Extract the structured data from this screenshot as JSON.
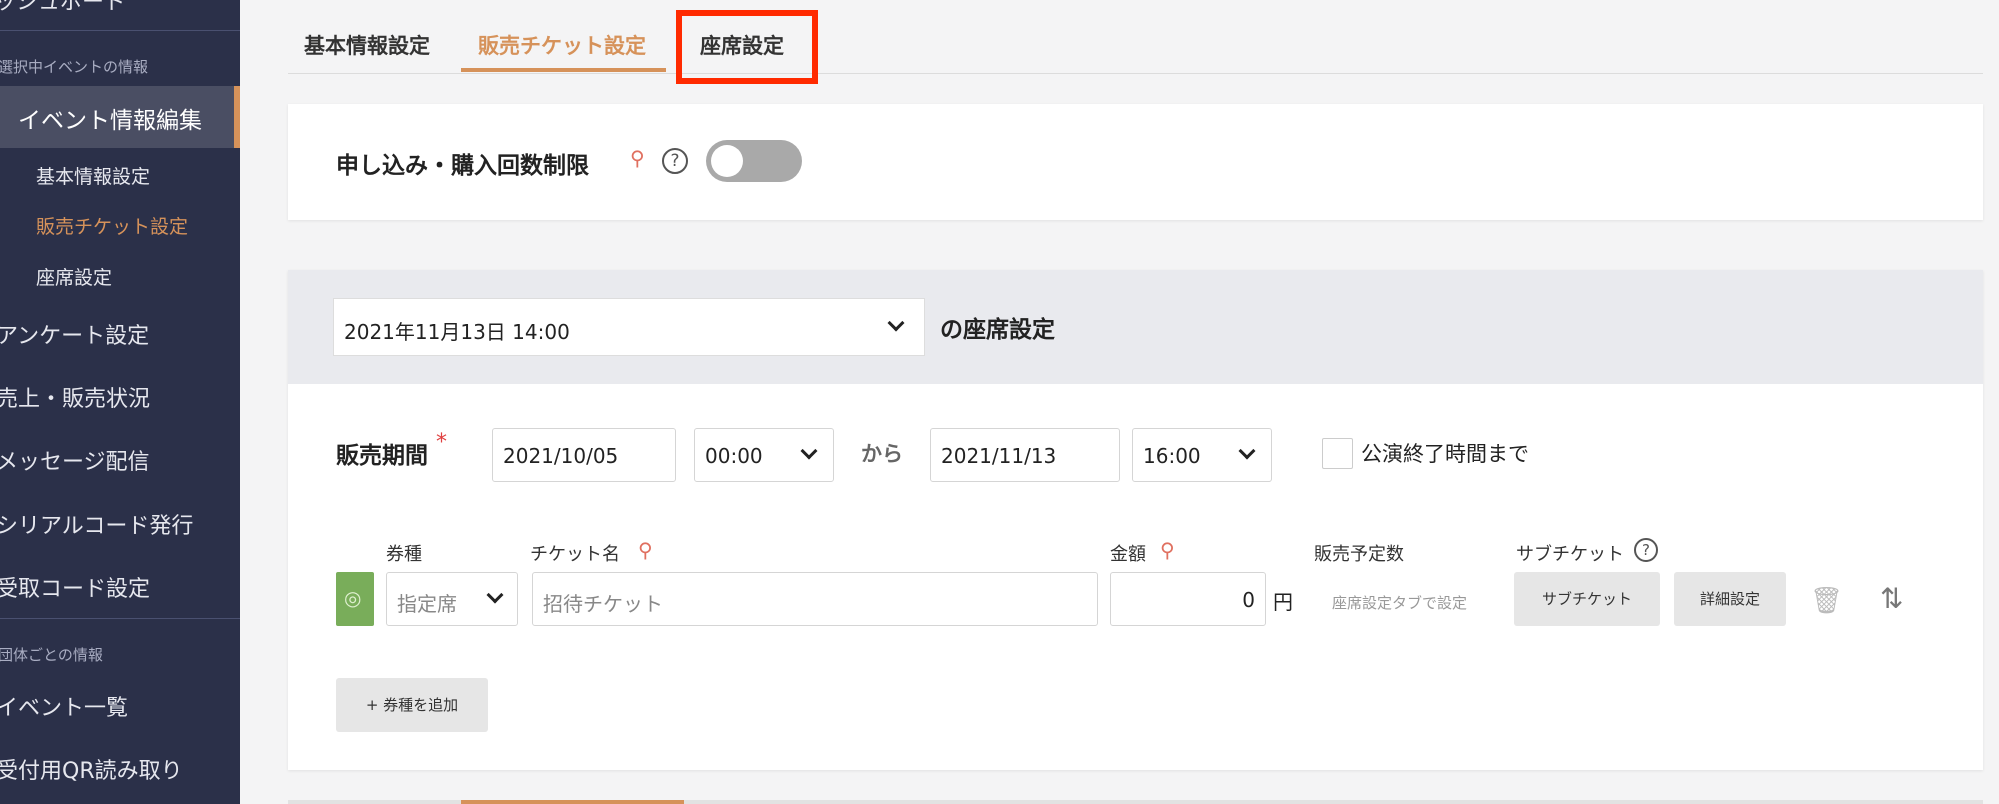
{
  "sidebar": {
    "top_item": "ッシュボード",
    "section_event": "選択中イベントの情報",
    "active_item": "イベント情報編集",
    "sub_items": [
      "基本情報設定",
      "販売チケット設定",
      "座席設定"
    ],
    "items": [
      "アンケート設定",
      "売上・販売状況",
      "メッセージ配信",
      "シリアルコード発行",
      "受取コード設定"
    ],
    "section_org": "団体ごとの情報",
    "org_items": [
      "イベント一覧",
      "受付用QR読み取り"
    ]
  },
  "tabs": [
    "基本情報設定",
    "販売チケット設定",
    "座席設定"
  ],
  "limit": {
    "label": "申し込み・購入回数制限",
    "enabled": false
  },
  "seat_settings": {
    "date_value": "2021年11月13日 14:00",
    "title": "の座席設定"
  },
  "sales_period": {
    "label": "販売期間",
    "required_mark": "*",
    "start_date": "2021/10/05",
    "start_time": "00:00",
    "from_label": "から",
    "end_date": "2021/11/13",
    "end_time": "16:00",
    "until_end_label": "公演終了時間まで"
  },
  "ticket_table": {
    "headers": {
      "type": "券種",
      "name": "チケット名",
      "price": "金額",
      "planned": "販売予定数",
      "sub": "サブチケット"
    },
    "row": {
      "type_value": "指定席",
      "name_placeholder": "招待チケット",
      "price_value": "0",
      "currency": "円",
      "planned_note": "座席設定タブで設定",
      "sub_button": "サブチケット",
      "detail_button": "詳細設定"
    },
    "add_button": "+ 券種を追加"
  },
  "icons": {
    "pin": "pin-off-icon",
    "help": "question-circle-icon",
    "eye": "eye-off-icon",
    "trash": "trash-icon",
    "sort": "sort-icon"
  },
  "colors": {
    "accent": "#d6925a",
    "sidebar": "#2b3049",
    "highlight": "#ff2a00",
    "green": "#79ad5a"
  }
}
